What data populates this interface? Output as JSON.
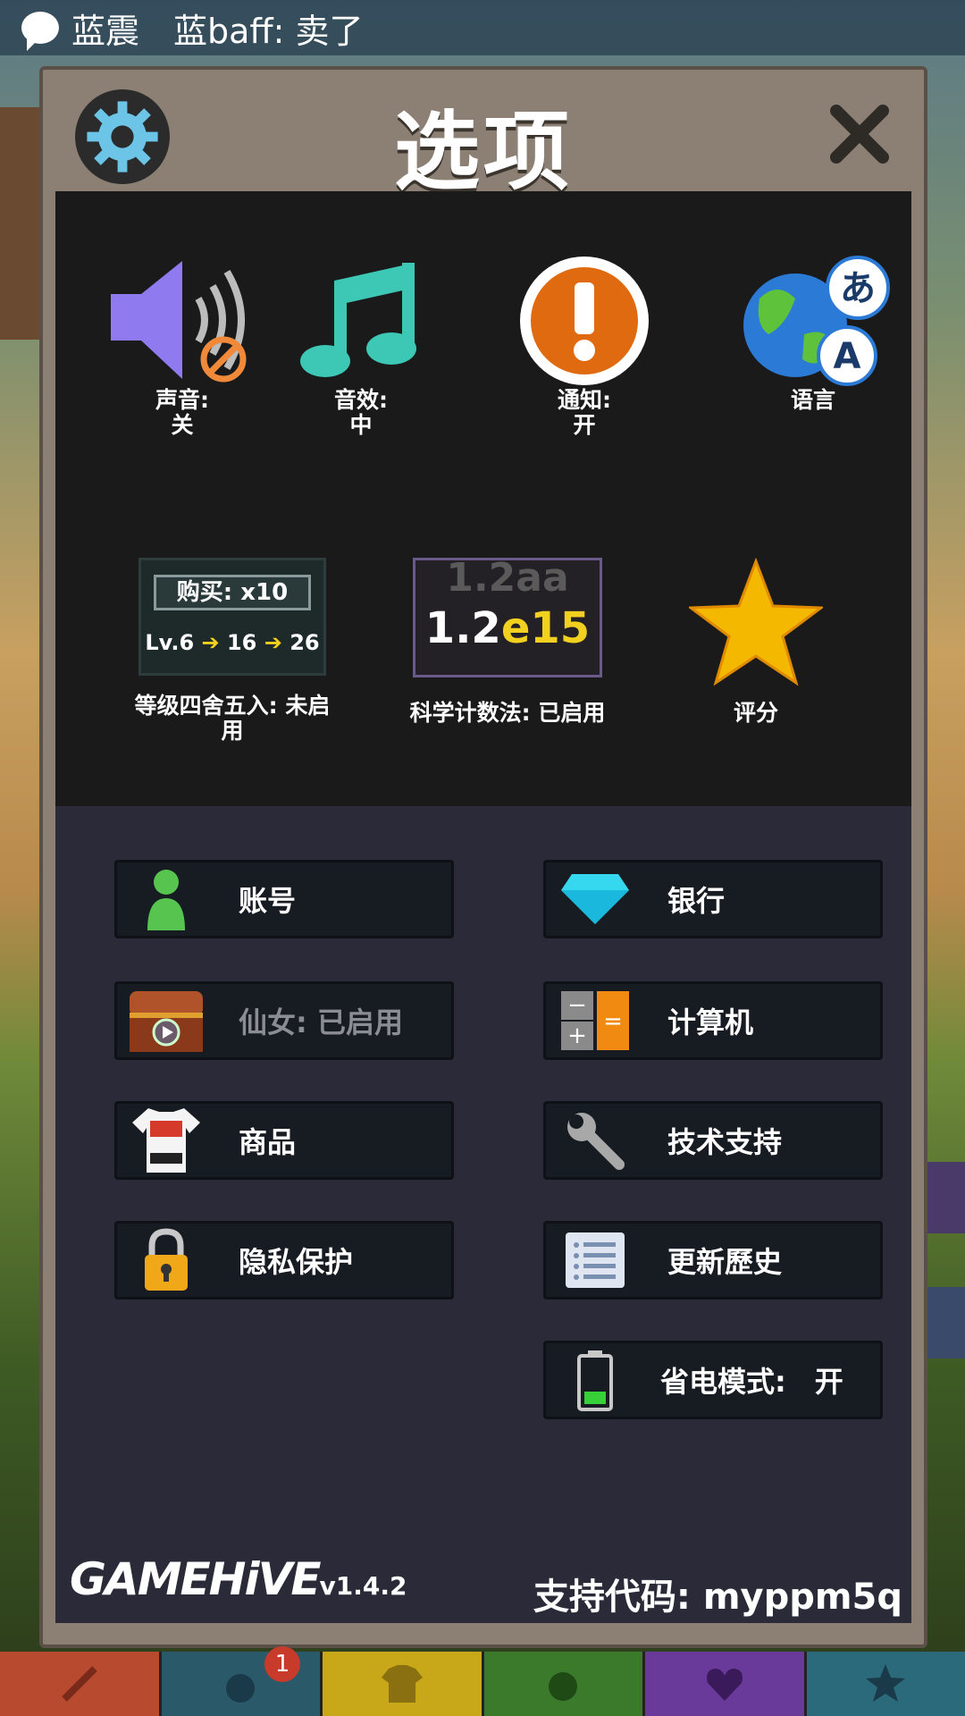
{
  "status_bar": {
    "notification": "蓝震　蓝baff: 卖了"
  },
  "modal": {
    "title": "选项",
    "top_options": [
      {
        "label": "声音:",
        "value": "关",
        "icon": "speaker-muted-icon"
      },
      {
        "label": "音效:",
        "value": "中",
        "icon": "music-note-icon"
      },
      {
        "label": "通知:",
        "value": "开",
        "icon": "exclamation-icon"
      },
      {
        "label": "语言",
        "value": "",
        "icon": "globe-language-icon"
      }
    ],
    "buy_preview": {
      "buy_label": "购买: x10",
      "lv": "Lv.6",
      "n1": "16",
      "n2": "26"
    },
    "sci_preview": {
      "top": "1.2aa",
      "base": "1.2",
      "exp": "e15"
    },
    "mid_options": [
      {
        "label": "等级四舍五入: 未启用"
      },
      {
        "label": "科学计数法: 已启用"
      },
      {
        "label": "评分"
      }
    ],
    "buttons": {
      "account": "账号",
      "bank": "银行",
      "fairy": "仙女: 已启用",
      "calculator": "计算机",
      "merch": "商品",
      "support": "技术支持",
      "privacy": "隐私保护",
      "changelog": "更新歷史",
      "battery": "省电模式:　开"
    },
    "footer": {
      "logo": "GAMEHiVE",
      "version": "v1.4.2",
      "support_code": "支持代码: myppm5q"
    }
  },
  "tabbar": {
    "badge": "1"
  },
  "colors": {
    "modal_frame": "#8c8074",
    "top_panel": "#1a1a1b",
    "bottom_panel": "#2a2a38",
    "button_bg": "#171b22"
  }
}
